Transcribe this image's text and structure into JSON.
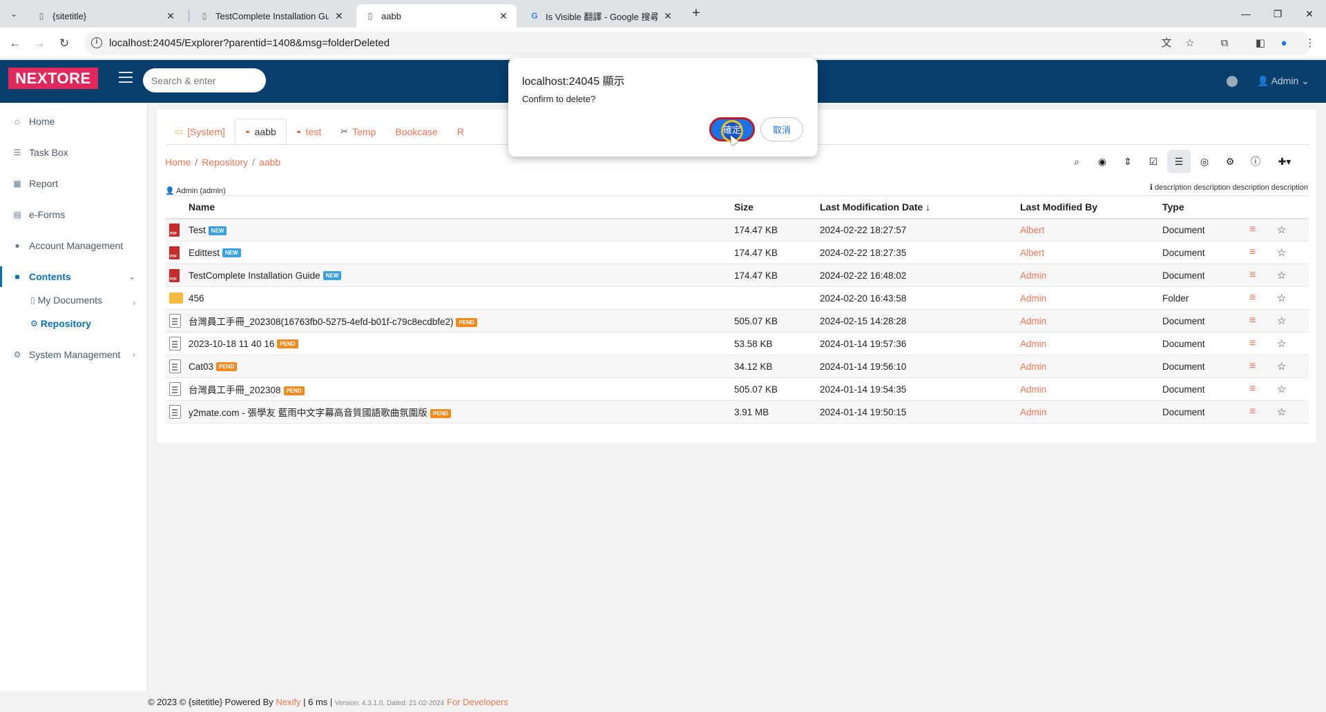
{
  "browser": {
    "tabs": [
      {
        "title": "{sitetitle}",
        "active": false
      },
      {
        "title": "TestComplete Installation Gui",
        "active": false
      },
      {
        "title": "aabb",
        "active": true
      },
      {
        "title": "Is Visible 翻譯 - Google 搜尋",
        "active": false
      }
    ],
    "url": "localhost:24045/Explorer?parentid=1408&msg=folderDeleted"
  },
  "header": {
    "logo": "NEXTORE",
    "search_placeholder": "Search & enter",
    "user": "Admin"
  },
  "sidebar": {
    "items": [
      {
        "label": "Home",
        "icon": "home-icon"
      },
      {
        "label": "Task Box",
        "icon": "tasks-icon"
      },
      {
        "label": "Report",
        "icon": "table-icon"
      },
      {
        "label": "e-Forms",
        "icon": "form-icon"
      },
      {
        "label": "Account Management",
        "icon": "user-icon"
      },
      {
        "label": "Contents",
        "icon": "folder-icon"
      },
      {
        "label": "System Management",
        "icon": "cogs-icon"
      }
    ],
    "sub_items": [
      {
        "label": "My Documents",
        "icon": "file-icon"
      },
      {
        "label": "Repository",
        "icon": "sitemap-icon"
      }
    ]
  },
  "repo_tabs": [
    "[System]",
    "aabb",
    "test",
    "Temp",
    "Bookcase",
    "R"
  ],
  "breadcrumb": [
    "Home",
    "Repository",
    "aabb"
  ],
  "owner": "Admin (admin)",
  "description": "description description description description",
  "table": {
    "headers": [
      "Name",
      "Size",
      "Last Modification Date",
      "Last Modified By",
      "Type"
    ],
    "rows": [
      {
        "icon": "pdf",
        "name": "Test",
        "badge": "NEW",
        "size": "174.47 KB",
        "date": "2024-02-22 18:27:57",
        "by": "Albert",
        "type": "Document"
      },
      {
        "icon": "pdf",
        "name": "Edittest",
        "badge": "NEW",
        "size": "174.47 KB",
        "date": "2024-02-22 18:27:35",
        "by": "Albert",
        "type": "Document"
      },
      {
        "icon": "pdf",
        "name": "TestComplete Installation Guide",
        "badge": "NEW",
        "size": "174.47 KB",
        "date": "2024-02-22 16:48:02",
        "by": "Admin",
        "type": "Document"
      },
      {
        "icon": "folder",
        "name": "456",
        "badge": "",
        "size": "",
        "date": "2024-02-20 16:43:58",
        "by": "Admin",
        "type": "Folder"
      },
      {
        "icon": "doc",
        "name": "台灣員工手冊_202308(16763fb0-5275-4efd-b01f-c79c8ecdbfe2)",
        "badge": "PEND",
        "size": "505.07 KB",
        "date": "2024-02-15 14:28:28",
        "by": "Admin",
        "type": "Document"
      },
      {
        "icon": "doc",
        "name": "2023-10-18 11 40 16",
        "badge": "PEND",
        "size": "53.58 KB",
        "date": "2024-01-14 19:57:36",
        "by": "Admin",
        "type": "Document"
      },
      {
        "icon": "doc",
        "name": "Cat03",
        "badge": "PEND",
        "size": "34.12 KB",
        "date": "2024-01-14 19:56:10",
        "by": "Admin",
        "type": "Document"
      },
      {
        "icon": "doc",
        "name": "台灣員工手冊_202308",
        "badge": "PEND",
        "size": "505.07 KB",
        "date": "2024-01-14 19:54:35",
        "by": "Admin",
        "type": "Document"
      },
      {
        "icon": "doc",
        "name": "y2mate.com - 張學友 藍雨中文字幕高音質國語歌曲氛圍版",
        "badge": "PEND",
        "size": "3.91 MB",
        "date": "2024-01-14 19:50:15",
        "by": "Admin",
        "type": "Document"
      }
    ]
  },
  "footer": {
    "copyright": "© 2023 © {sitetitle} Powered By",
    "brand": "Nexify",
    "timing": "| 6 ms |",
    "version": "Version: 4.3.1.0, Dated: 21-02-2024",
    "dev_link": "For Developers"
  },
  "dialog": {
    "title": "localhost:24045 顯示",
    "message": "Confirm to delete?",
    "ok_label": "確定",
    "cancel_label": "取消"
  },
  "colors": {
    "header_bg": "#073e6b",
    "logo_bg": "#e0285a",
    "accent_link": "#e87757",
    "active_blue": "#0b6fb5",
    "dialog_button": "#1a73e8"
  }
}
